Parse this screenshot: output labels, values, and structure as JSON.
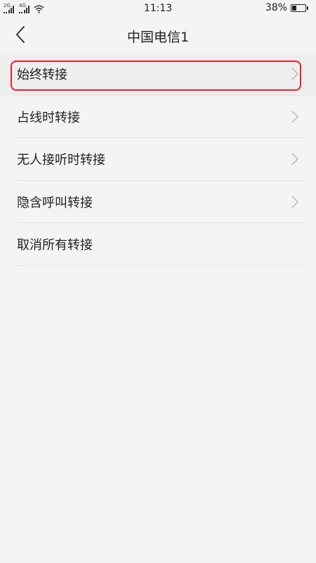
{
  "status_bar": {
    "sim1_network": "2G",
    "sim2_network": "4G",
    "time": "11:13",
    "battery_percent": "38%",
    "battery_level": 0.38
  },
  "header": {
    "title": "中国电信1"
  },
  "menu": {
    "items": [
      {
        "label": "始终转接",
        "has_chevron": true
      },
      {
        "label": "占线时转接",
        "has_chevron": true
      },
      {
        "label": "无人接听时转接",
        "has_chevron": true
      },
      {
        "label": "隐含呼叫转接",
        "has_chevron": true
      },
      {
        "label": "取消所有转接",
        "has_chevron": false
      }
    ]
  },
  "colors": {
    "background": "#f4f4f4",
    "highlight": "#e8212b",
    "text": "#222222"
  }
}
